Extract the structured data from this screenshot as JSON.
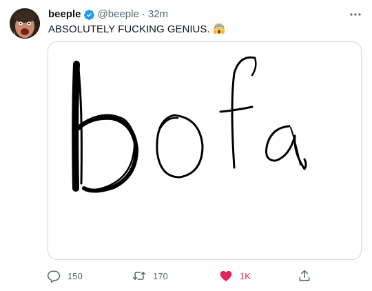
{
  "tweet": {
    "author": {
      "display_name": "beeple",
      "handle": "@beeple",
      "verified": true
    },
    "separator": "·",
    "time": "32m",
    "text": "ABSOLUTELY FUCKING GENIUS.",
    "emoji": "screaming-face-emoji",
    "media": {
      "drawn_text": "bofa"
    },
    "actions": {
      "reply_count": "150",
      "retweet_count": "170",
      "like_count": "1K",
      "liked": true
    },
    "colors": {
      "text": "#0f1419",
      "secondary": "#536471",
      "verified": "#1d9bf0",
      "like": "#e0245e",
      "border": "#cfd9de"
    },
    "icons": [
      "verified-badge-icon",
      "more-icon",
      "reply-icon",
      "retweet-icon",
      "heart-icon",
      "share-icon"
    ]
  }
}
